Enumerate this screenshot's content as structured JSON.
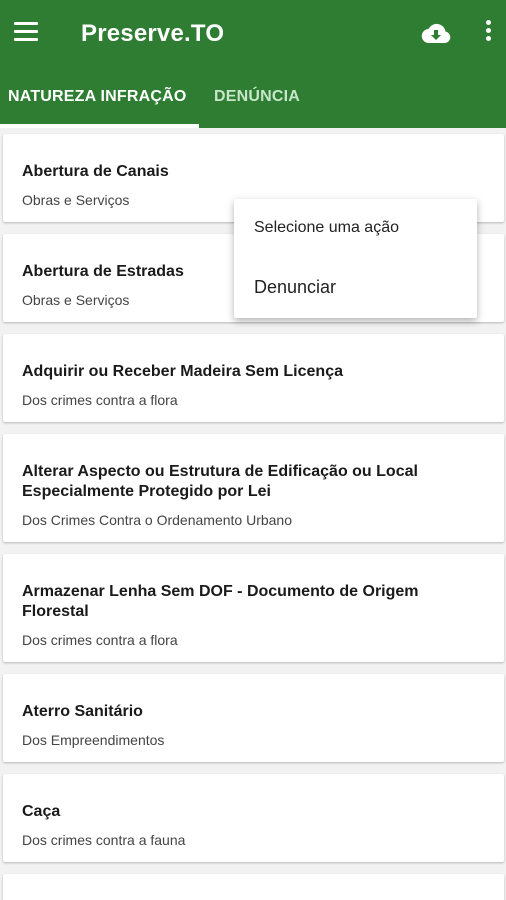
{
  "app": {
    "title": "Preserve.TO",
    "menu_icon": "hamburger-menu-icon",
    "download_icon": "cloud-download-icon",
    "more_icon": "more-vert-icon",
    "color_primary": "#2e7d32"
  },
  "tabs": [
    {
      "label": "NATUREZA INFRAÇÃO",
      "active": true
    },
    {
      "label": "DENÚNCIA",
      "active": false
    }
  ],
  "items": [
    {
      "title": "Abertura de Canais",
      "subtitle": "Obras e Serviços"
    },
    {
      "title": "Abertura de Estradas",
      "subtitle": "Obras e Serviços"
    },
    {
      "title": "Adquirir ou Receber  Madeira Sem Licença",
      "subtitle": "Dos crimes contra a flora"
    },
    {
      "title": "Alterar Aspecto ou Estrutura de Edificação ou Local Especialmente Protegido por Lei",
      "subtitle": "Dos Crimes Contra o Ordenamento Urbano"
    },
    {
      "title": "Armazenar Lenha Sem DOF - Documento de Origem Florestal",
      "subtitle": "Dos crimes contra a flora"
    },
    {
      "title": "Aterro Sanitário",
      "subtitle": "Dos Empreendimentos"
    },
    {
      "title": "Caça",
      "subtitle": "Dos crimes contra a fauna"
    }
  ],
  "popup": {
    "header": "Selecione uma ação",
    "action": "Denunciar"
  }
}
